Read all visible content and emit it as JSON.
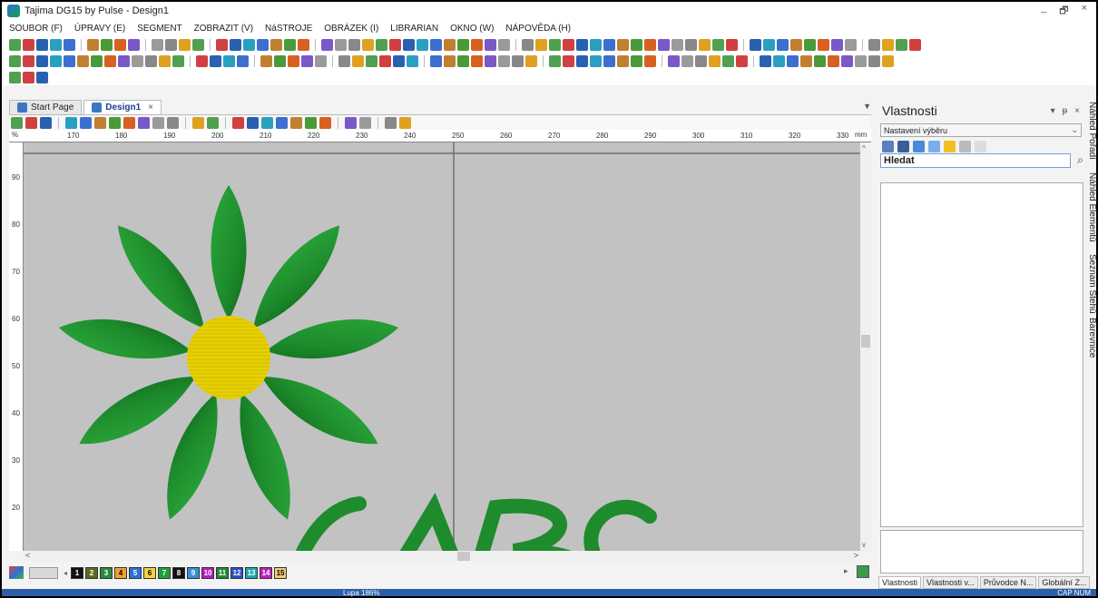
{
  "window": {
    "title": "Tajima DG15 by Pulse - Design1",
    "controls": [
      "_",
      "🗗",
      "×"
    ]
  },
  "menu": [
    "SOUBOR (F)",
    "ÚPRAVY (E)",
    "SEGMENT",
    "ZOBRAZIT (V)",
    "NáSTROJE",
    "OBRÁZEK (I)",
    "LIBRARIAN",
    "OKNO (W)",
    "NÁPOVĚDA (H)"
  ],
  "doc_tabs": [
    {
      "label": "Start Page"
    },
    {
      "label": "Design1",
      "close": "×"
    }
  ],
  "ruler": {
    "unit": "mm",
    "corner": "%",
    "x_ticks": [
      "170",
      "180",
      "190",
      "200",
      "210",
      "220",
      "230",
      "240",
      "250",
      "260",
      "270",
      "280",
      "290",
      "300",
      "310",
      "320",
      "330"
    ],
    "y_ticks": [
      "90",
      "80",
      "70",
      "60",
      "50",
      "40",
      "30",
      "20"
    ]
  },
  "palette": {
    "swatches": [
      {
        "num": "1",
        "color": "#111111",
        "text": "#ffffff"
      },
      {
        "num": "2",
        "color": "#5a6b1f",
        "text": "#ffffff"
      },
      {
        "num": "3",
        "color": "#2b8a3e",
        "text": "#ffffff"
      },
      {
        "num": "4",
        "color": "#f0a030",
        "text": "#000000"
      },
      {
        "num": "5",
        "color": "#2c6fd6",
        "text": "#ffffff"
      },
      {
        "num": "6",
        "color": "#f4d23a",
        "text": "#000000"
      },
      {
        "num": "7",
        "color": "#1fa03a",
        "text": "#ffffff"
      },
      {
        "num": "8",
        "color": "#111111",
        "text": "#ffffff"
      },
      {
        "num": "9",
        "color": "#3a8fd8",
        "text": "#ffffff"
      },
      {
        "num": "10",
        "color": "#b01ec0",
        "text": "#ffffff"
      },
      {
        "num": "11",
        "color": "#1e8a3a",
        "text": "#ffffff"
      },
      {
        "num": "12",
        "color": "#2a4fc8",
        "text": "#ffffff"
      },
      {
        "num": "13",
        "color": "#17a8b0",
        "text": "#ffffff"
      },
      {
        "num": "14",
        "color": "#c020c0",
        "text": "#ffffff"
      },
      {
        "num": "15",
        "color": "#f4c878",
        "text": "#000000"
      }
    ]
  },
  "properties": {
    "title": "Vlastnosti",
    "controls": [
      "▾",
      "ᵽ",
      "×"
    ],
    "selector_value": "Nastavení výběru",
    "search_value": "Hledat",
    "bottom_tabs": [
      "Vlastnosti",
      "Vlastnosti v...",
      "Průvodce N...",
      "Globální Z..."
    ]
  },
  "side_tabs": [
    "Náhled Pořadí",
    "Náhled Elementů",
    "Seznam Stehů",
    "Barevnice"
  ],
  "status": {
    "center": "Lupa 186%",
    "right": "CAP NUM"
  },
  "design": {
    "petal_color": "#1e8b2c",
    "center_color": "#e6d000",
    "lettering": "ABC"
  }
}
